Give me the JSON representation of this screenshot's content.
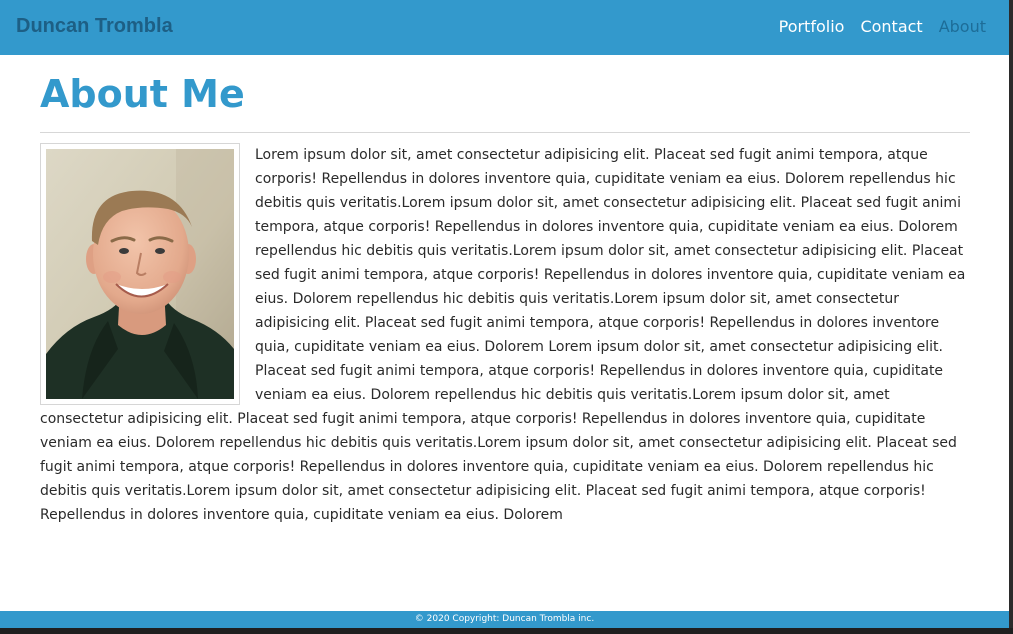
{
  "nav": {
    "brand": "Duncan Trombla",
    "links": [
      "Portfolio",
      "Contact",
      "About"
    ],
    "active_link": "About"
  },
  "main": {
    "title": "About Me",
    "photo_alt": "Portrait photo",
    "body": "Lorem ipsum dolor sit, amet consectetur adipisicing elit. Placeat sed fugit animi tempora, atque corporis! Repellendus in dolores inventore quia, cupiditate veniam ea eius. Dolorem repellendus hic debitis quis veritatis.Lorem ipsum dolor sit, amet consectetur adipisicing elit. Placeat sed fugit animi tempora, atque corporis! Repellendus in dolores inventore quia, cupiditate veniam ea eius. Dolorem repellendus hic debitis quis veritatis.Lorem ipsum dolor sit, amet consectetur adipisicing elit. Placeat sed fugit animi tempora, atque corporis! Repellendus in dolores inventore quia, cupiditate veniam ea eius. Dolorem repellendus hic debitis quis veritatis.Lorem ipsum dolor sit, amet consectetur adipisicing elit. Placeat sed fugit animi tempora, atque corporis! Repellendus in dolores inventore quia, cupiditate veniam ea eius. Dolorem Lorem ipsum dolor sit, amet consectetur adipisicing elit. Placeat sed fugit animi tempora, atque corporis! Repellendus in dolores inventore quia, cupiditate veniam ea eius. Dolorem repellendus hic debitis quis veritatis.Lorem ipsum dolor sit, amet consectetur adipisicing elit. Placeat sed fugit animi tempora, atque corporis! Repellendus in dolores inventore quia, cupiditate veniam ea eius. Dolorem repellendus hic debitis quis veritatis.Lorem ipsum dolor sit, amet consectetur adipisicing elit. Placeat sed fugit animi tempora, atque corporis! Repellendus in dolores inventore quia, cupiditate veniam ea eius. Dolorem repellendus hic debitis quis veritatis.Lorem ipsum dolor sit, amet consectetur adipisicing elit. Placeat sed fugit animi tempora, atque corporis! Repellendus in dolores inventore quia, cupiditate veniam ea eius. Dolorem"
  },
  "footer": {
    "text": "© 2020 Copyright: Duncan Trombla inc."
  },
  "colors": {
    "primary": "#3399cc",
    "brand_text": "#1d5f85",
    "active_link": "#1d6d98",
    "nav_text": "#ffffff",
    "body_text": "#2a2a2a"
  }
}
